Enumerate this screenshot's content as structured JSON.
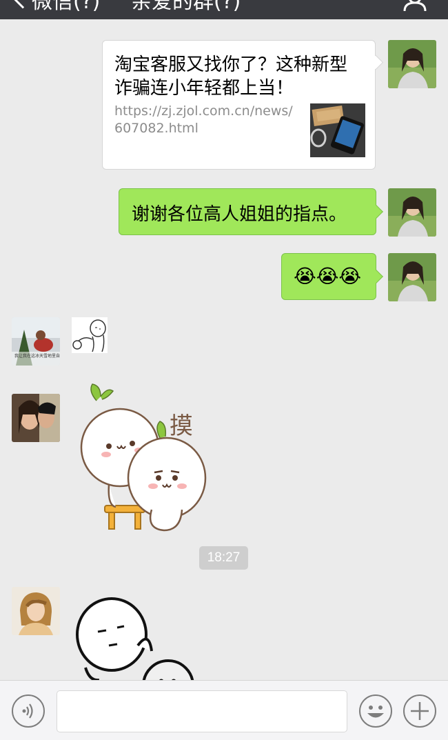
{
  "header": {
    "back_label": "微信(?)",
    "title": "亲爱的群(?)"
  },
  "messages": {
    "link_card": {
      "title": "淘宝客服又找你了？这种新型诈骗连小年轻都上当！",
      "url": "https://zj.zjol.com.cn/news/607082.html"
    },
    "thanks_text": "谢谢各位高人姐姐的指点。",
    "emoji_text": "😭😭😭",
    "sticker_word": "摸",
    "avatar1_caption": "我让我在这冰天雪地里自由心问",
    "timestamp": "18:27"
  },
  "input_bar": {
    "message_value": ""
  },
  "colors": {
    "header_bg": "#393a3f",
    "chat_bg": "#ebebeb",
    "sent_bubble": "#a0e75a",
    "timestamp_pill": "#cecece"
  },
  "icons": {
    "voice": "voice-icon",
    "emoji": "emoji-icon",
    "more": "plus-icon",
    "back": "chevron-left-icon",
    "profile": "person-icon"
  }
}
